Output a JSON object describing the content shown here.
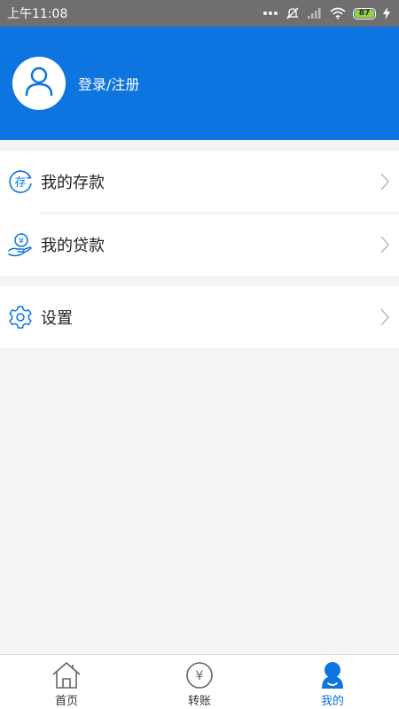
{
  "status_bar": {
    "time": "上午11:08",
    "battery": "87",
    "battery_color": "#8cd34a"
  },
  "header": {
    "login_label": "登录/注册",
    "background_color": "#0e74e0",
    "avatar_icon": "user-outline-icon"
  },
  "menu": {
    "group1": [
      {
        "label": "我的存款",
        "icon": "deposit-icon"
      },
      {
        "label": "我的贷款",
        "icon": "loan-icon"
      }
    ],
    "group2": [
      {
        "label": "设置",
        "icon": "gear-icon"
      }
    ]
  },
  "bottom_nav": {
    "tabs": [
      {
        "label": "首页",
        "icon": "home-icon",
        "active": false
      },
      {
        "label": "转账",
        "icon": "yen-icon",
        "active": false
      },
      {
        "label": "我的",
        "icon": "user-filled-icon",
        "active": true
      }
    ]
  },
  "colors": {
    "accent": "#0e74e0",
    "page_background": "#f4f4f4"
  }
}
